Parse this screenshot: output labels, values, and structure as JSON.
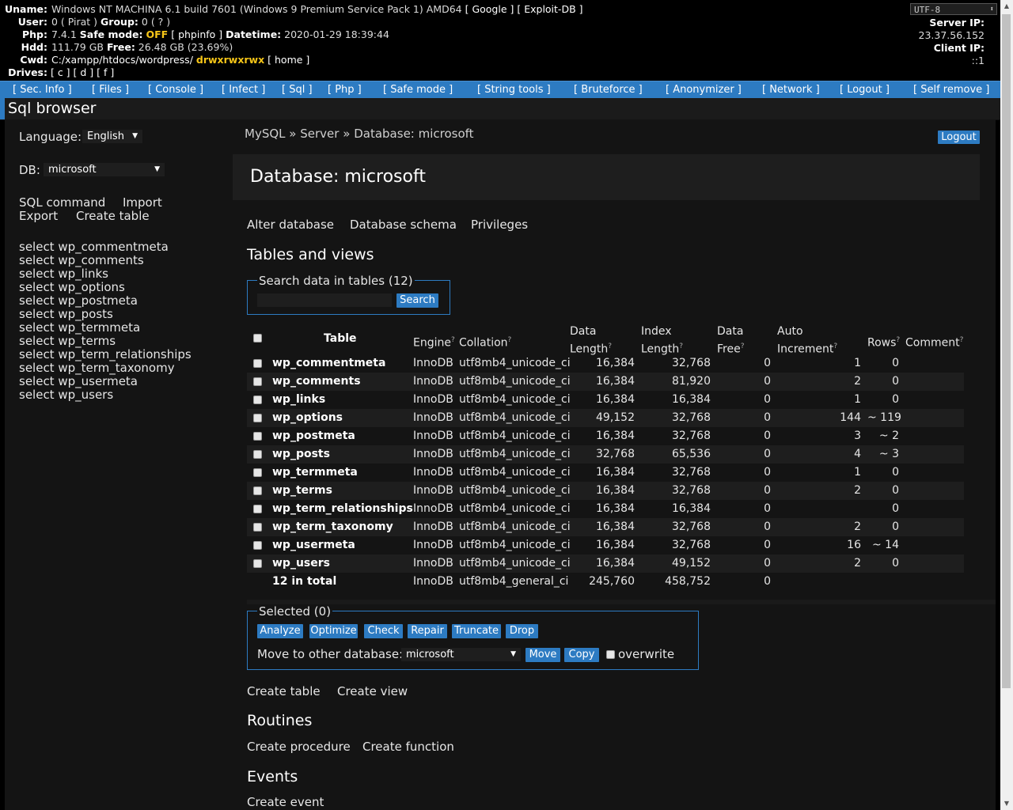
{
  "info": {
    "uname_label": "Uname:",
    "uname_value": "Windows NT MACHINA 6.1 build 7601 (Windows 9 Premium Service Pack 1) AMD64",
    "uname_links": [
      "[ Google ]",
      "[ Exploit-DB ]"
    ],
    "user_label": "User:",
    "user_value": "0 ( Pirat )",
    "group_label": "Group:",
    "group_value": "0 ( ? )",
    "php_label": "Php:",
    "php_value": "7.4.1",
    "safe_mode_label": "Safe mode:",
    "safe_mode_value": "OFF",
    "phpinfo_link": "[ phpinfo ]",
    "datetime_label": "Datetime:",
    "datetime_value": "2020-01-29 18:39:44",
    "hdd_label": "Hdd:",
    "hdd_value": "111.79 GB",
    "free_label": "Free:",
    "free_value": "26.48 GB (23.69%)",
    "cwd_label": "Cwd:",
    "cwd_value": "C:/xampp/htdocs/wordpress/",
    "cwd_perms": "drwxrwxrwx",
    "cwd_home": "[ home ]",
    "drives_label": "Drives:",
    "drives": [
      "[ c ]",
      "[ d ]",
      "[ f ]"
    ],
    "encoding": "UTF-8",
    "server_ip_label": "Server IP:",
    "server_ip": "23.37.56.152",
    "client_ip_label": "Client IP:",
    "client_ip": "::1",
    "colors": {
      "accent": "#2d7bc2",
      "highlight": "#f5c518",
      "background": "#000000"
    }
  },
  "menu": [
    "[ Sec. Info ]",
    "[ Files ]",
    "[ Console ]",
    "[ Infect ]",
    "[ Sql ]",
    "[ Php ]",
    "[ Safe mode ]",
    "[ String tools ]",
    "[ Bruteforce ]",
    "[ Anonymizer ]",
    "[ Network ]",
    "[ Logout ]",
    "[ Self remove ]"
  ],
  "page_title": "Sql browser",
  "sidebar": {
    "language_label": "Language:",
    "language_value": "English",
    "db_label": "DB:",
    "db_value": "microsoft",
    "links": [
      "SQL command",
      "Import",
      "Export",
      "Create table"
    ],
    "selects": [
      "select wp_commentmeta",
      "select wp_comments",
      "select wp_links",
      "select wp_options",
      "select wp_postmeta",
      "select wp_posts",
      "select wp_termmeta",
      "select wp_terms",
      "select wp_term_relationships",
      "select wp_term_taxonomy",
      "select wp_usermeta",
      "select wp_users"
    ]
  },
  "breadcrumb": {
    "items": [
      "MySQL",
      "Server",
      "Database: microsoft"
    ],
    "sep": "»"
  },
  "logout_label": "Logout",
  "main": {
    "title": "Database: microsoft",
    "actions": [
      "Alter database",
      "Database schema",
      "Privileges"
    ],
    "tables_heading": "Tables and views",
    "search_legend": "Search data in tables (12)",
    "search_value": "",
    "search_button": "Search",
    "columns": {
      "table": "Table",
      "engine": "Engine",
      "collation": "Collation",
      "data_length_1": "Data",
      "data_length_2": "Length",
      "index_length_1": "Index",
      "index_length_2": "Length",
      "data_free_1": "Data",
      "data_free_2": "Free",
      "auto_inc_1": "Auto",
      "auto_inc_2": "Increment",
      "rows": "Rows",
      "comment": "Comment",
      "help_mark": "?"
    },
    "rows": [
      {
        "name": "wp_commentmeta",
        "engine": "InnoDB",
        "collation": "utf8mb4_unicode_ci",
        "data_length": "16,384",
        "index_length": "32,768",
        "data_free": "0",
        "auto_increment": "1",
        "rows": "0"
      },
      {
        "name": "wp_comments",
        "engine": "InnoDB",
        "collation": "utf8mb4_unicode_ci",
        "data_length": "16,384",
        "index_length": "81,920",
        "data_free": "0",
        "auto_increment": "2",
        "rows": "0"
      },
      {
        "name": "wp_links",
        "engine": "InnoDB",
        "collation": "utf8mb4_unicode_ci",
        "data_length": "16,384",
        "index_length": "16,384",
        "data_free": "0",
        "auto_increment": "1",
        "rows": "0"
      },
      {
        "name": "wp_options",
        "engine": "InnoDB",
        "collation": "utf8mb4_unicode_ci",
        "data_length": "49,152",
        "index_length": "32,768",
        "data_free": "0",
        "auto_increment": "144",
        "rows": "~ 119"
      },
      {
        "name": "wp_postmeta",
        "engine": "InnoDB",
        "collation": "utf8mb4_unicode_ci",
        "data_length": "16,384",
        "index_length": "32,768",
        "data_free": "0",
        "auto_increment": "3",
        "rows": "~ 2"
      },
      {
        "name": "wp_posts",
        "engine": "InnoDB",
        "collation": "utf8mb4_unicode_ci",
        "data_length": "32,768",
        "index_length": "65,536",
        "data_free": "0",
        "auto_increment": "4",
        "rows": "~ 3"
      },
      {
        "name": "wp_termmeta",
        "engine": "InnoDB",
        "collation": "utf8mb4_unicode_ci",
        "data_length": "16,384",
        "index_length": "32,768",
        "data_free": "0",
        "auto_increment": "1",
        "rows": "0"
      },
      {
        "name": "wp_terms",
        "engine": "InnoDB",
        "collation": "utf8mb4_unicode_ci",
        "data_length": "16,384",
        "index_length": "32,768",
        "data_free": "0",
        "auto_increment": "2",
        "rows": "0"
      },
      {
        "name": "wp_term_relationships",
        "engine": "InnoDB",
        "collation": "utf8mb4_unicode_ci",
        "data_length": "16,384",
        "index_length": "16,384",
        "data_free": "0",
        "auto_increment": "",
        "rows": "0"
      },
      {
        "name": "wp_term_taxonomy",
        "engine": "InnoDB",
        "collation": "utf8mb4_unicode_ci",
        "data_length": "16,384",
        "index_length": "32,768",
        "data_free": "0",
        "auto_increment": "2",
        "rows": "0"
      },
      {
        "name": "wp_usermeta",
        "engine": "InnoDB",
        "collation": "utf8mb4_unicode_ci",
        "data_length": "16,384",
        "index_length": "32,768",
        "data_free": "0",
        "auto_increment": "16",
        "rows": "~ 14"
      },
      {
        "name": "wp_users",
        "engine": "InnoDB",
        "collation": "utf8mb4_unicode_ci",
        "data_length": "16,384",
        "index_length": "49,152",
        "data_free": "0",
        "auto_increment": "2",
        "rows": "0"
      }
    ],
    "total": {
      "name": "12 in total",
      "engine": "InnoDB",
      "collation": "utf8mb4_general_ci",
      "data_length": "245,760",
      "index_length": "458,752",
      "data_free": "0"
    },
    "selected_legend": "Selected (0)",
    "bulk_buttons": [
      "Analyze",
      "Optimize",
      "Check",
      "Repair",
      "Truncate",
      "Drop"
    ],
    "move_label": "Move to other database:",
    "move_db": "microsoft",
    "move_button": "Move",
    "copy_button": "Copy",
    "overwrite_label": "overwrite",
    "create_links": [
      "Create table",
      "Create view"
    ],
    "routines_heading": "Routines",
    "routine_links": [
      "Create procedure",
      "Create function"
    ],
    "events_heading": "Events",
    "event_links": [
      "Create event"
    ]
  }
}
